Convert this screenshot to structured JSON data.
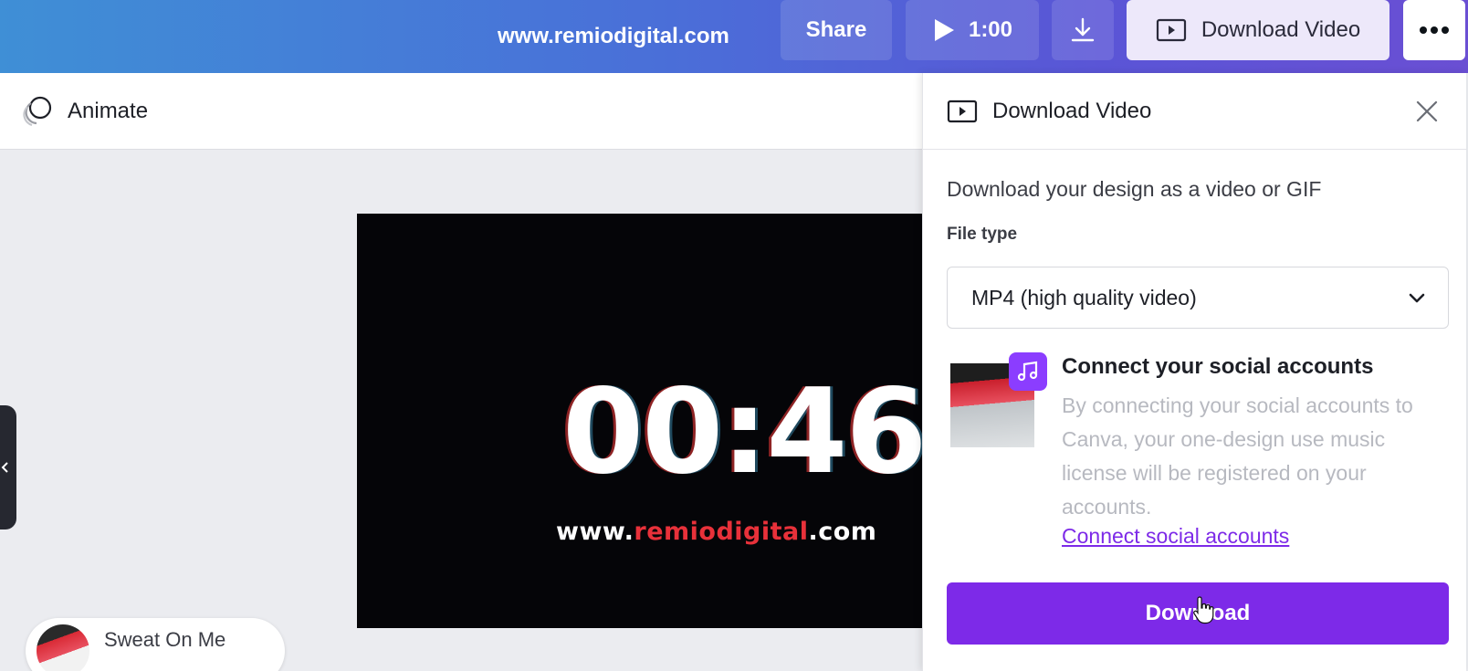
{
  "topbar": {
    "site_url": "www.remiodigital.com",
    "share_label": "Share",
    "play_duration": "1:00",
    "download_video_label": "Download Video"
  },
  "toolbar": {
    "animate_label": "Animate"
  },
  "canvas": {
    "timer_text": "00:46",
    "url_prefix": "www.",
    "url_mid": "remiodigital",
    "url_suffix": ".com"
  },
  "music_chip": {
    "title": "Sweat On Me"
  },
  "panel": {
    "title": "Download Video",
    "description": "Download your design as a video or GIF",
    "file_type_label": "File type",
    "file_type_value": "MP4 (high quality video)",
    "social_title": "Connect your social accounts",
    "social_body": "By connecting your social accounts to Canva, your one-design use music license will be registered on your accounts.",
    "social_link": "Connect social accounts",
    "download_label": "Download"
  },
  "colors": {
    "accent": "#7d2ae8",
    "badge": "#8b3dff",
    "url_red": "#e8313a"
  },
  "icons": {
    "play": "play-icon",
    "download": "download-arrow-icon",
    "video": "video-icon",
    "more": "more-dots-icon",
    "animate": "animate-icon",
    "close": "close-icon",
    "chevron": "chevron-down-icon",
    "music": "music-note-icon",
    "collapse": "chevron-left-icon",
    "cursor": "hand-cursor-icon"
  }
}
